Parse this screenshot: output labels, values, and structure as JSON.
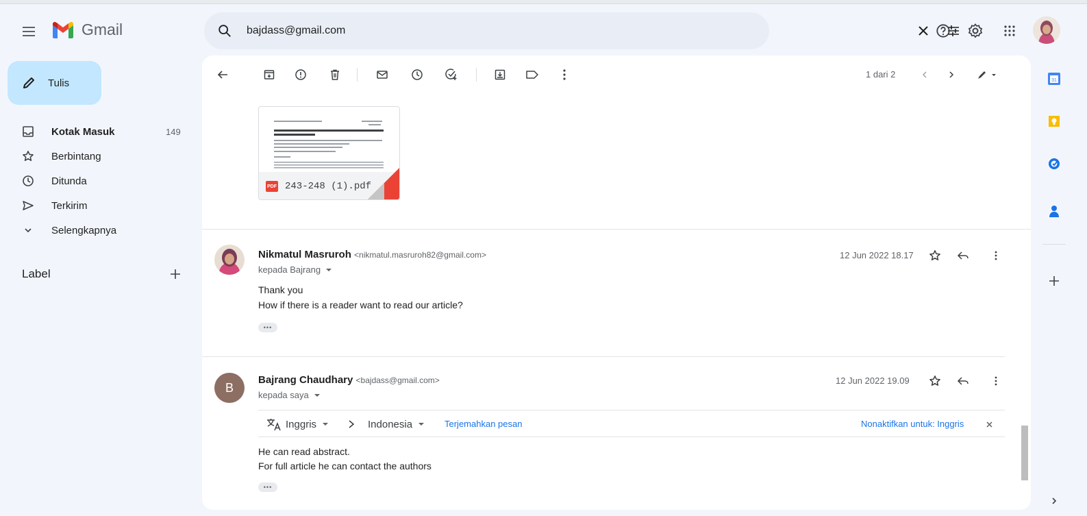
{
  "app": {
    "name": "Gmail"
  },
  "search": {
    "value": "bajdass@gmail.com"
  },
  "compose": {
    "label": "Tulis"
  },
  "nav": [
    {
      "label": "Kotak Masuk",
      "count": "149",
      "icon": "inbox-icon",
      "bold": true
    },
    {
      "label": "Berbintang",
      "count": "",
      "icon": "star-icon"
    },
    {
      "label": "Ditunda",
      "count": "",
      "icon": "clock-icon"
    },
    {
      "label": "Terkirim",
      "count": "",
      "icon": "send-icon"
    },
    {
      "label": "Selengkapnya",
      "count": "",
      "icon": "chevron-down-icon"
    }
  ],
  "labels_header": "Label",
  "toolbar": {
    "pager": "1 dari 2"
  },
  "attachment": {
    "filename": "243-248 (1).pdf",
    "badge": "PDF",
    "preview_title": "The Halal Branding to International Trade of Indonesian Seafood Agricultural Products"
  },
  "messages": [
    {
      "sender_name": "Nikmatul Masruroh",
      "sender_email": "<nikmatul.masruroh82@gmail.com>",
      "recipient": "kepada Bajrang",
      "date": "12 Jun 2022 18.17",
      "body": [
        "Thank you",
        "How if there is a reader want to read our article?"
      ],
      "ellipsis": "•••"
    },
    {
      "sender_name": "Bajrang Chaudhary",
      "sender_email": "<bajdass@gmail.com>",
      "recipient": "kepada saya",
      "avatar_letter": "B",
      "date": "12 Jun 2022 19.09",
      "body": [
        "He can read abstract.",
        "For full article he can contact the authors"
      ],
      "ellipsis": "•••"
    }
  ],
  "translate": {
    "from": "Inggris",
    "to": "Indonesia",
    "action": "Terjemahkan pesan",
    "disable": "Nonaktifkan untuk: Inggris"
  },
  "colors": {
    "compose_bg": "#c2e7ff",
    "background": "#f2f6fc",
    "link": "#1a73e8",
    "pdf_red": "#ea4335",
    "avatar_b": "#8d6e63"
  }
}
